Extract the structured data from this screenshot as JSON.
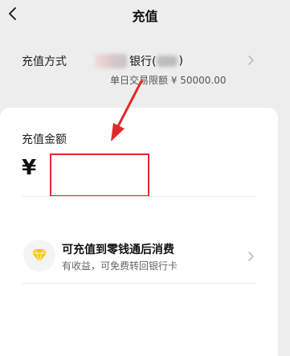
{
  "header": {
    "title": "充值",
    "back_icon": "back-chevron-icon"
  },
  "payment_method": {
    "label": "充值方式",
    "bank_name_middle": "银行(",
    "bank_name_end": ")",
    "daily_limit": "单日交易限额 ¥ 50000.00",
    "chevron_icon": "chevron-right-icon"
  },
  "amount": {
    "label": "充值金额",
    "currency_symbol": "¥",
    "value": ""
  },
  "promo": {
    "icon": "diamond-icon",
    "title": "可充值到零钱通后消费",
    "subtitle": "有收益，可免费转回银行卡",
    "chevron_icon": "chevron-right-icon"
  },
  "colors": {
    "highlight_red": "#e02a2a",
    "diamond_gold": "#f5c518",
    "background": "#ededed"
  }
}
